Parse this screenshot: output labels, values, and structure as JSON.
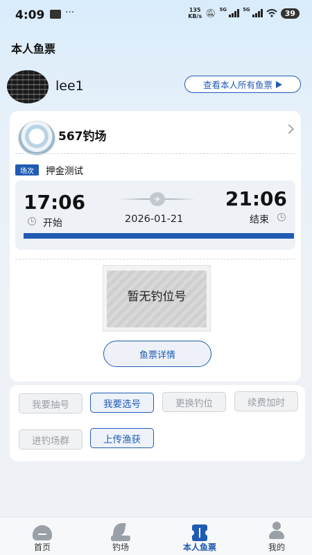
{
  "status_bar": {
    "time": "4:09",
    "more": "···",
    "net_speed_value": "135",
    "net_speed_unit": "KB/s",
    "signal_1_label": "5G",
    "signal_2_label": "5G",
    "battery": "39"
  },
  "page_title": "本人鱼票",
  "user": {
    "name": "lee1",
    "view_all_label": "查看本人所有鱼票"
  },
  "ticket": {
    "venue_name": "567钓场",
    "session_tag": "场次",
    "session_name": "押金测试",
    "start_time": "17:06",
    "end_time": "21:06",
    "start_label": "开始",
    "end_label": "结束",
    "date": "2026-01-21",
    "progress": 1.0,
    "spot_text": "暂无钓位号",
    "detail_label": "鱼票详情"
  },
  "actions": [
    {
      "label": "我要抽号",
      "active": false
    },
    {
      "label": "我要选号",
      "active": true
    },
    {
      "label": "更换钓位",
      "active": false
    },
    {
      "label": "续费加时",
      "active": false
    },
    {
      "label": "进钓场群",
      "active": false
    },
    {
      "label": "上传渔获",
      "active": true
    }
  ],
  "nav": [
    {
      "label": "首页",
      "icon": "home-icon"
    },
    {
      "label": "钓场",
      "icon": "venue-icon"
    },
    {
      "label": "本人鱼票",
      "icon": "ticket-icon",
      "active": true
    },
    {
      "label": "我的",
      "icon": "user-icon"
    }
  ],
  "colors": {
    "accent": "#1f5bb3",
    "disabled_text": "#9a9ea5"
  }
}
